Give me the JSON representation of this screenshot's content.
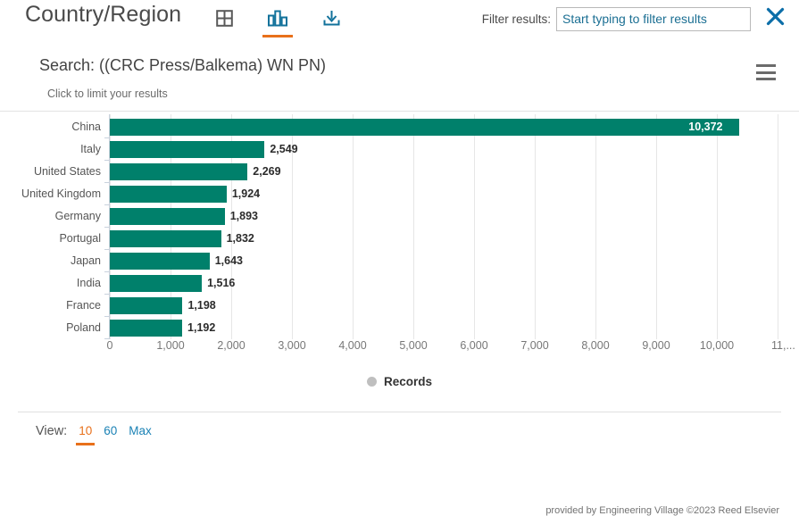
{
  "header": {
    "title": "Country/Region",
    "icons": [
      {
        "name": "table-view-icon",
        "label": "Table view"
      },
      {
        "name": "bar-chart-view-icon",
        "label": "Bar chart view",
        "active": true
      },
      {
        "name": "download-icon",
        "label": "Download"
      }
    ],
    "filter_label": "Filter results:",
    "filter_placeholder": "Start typing to filter results",
    "filter_value": "",
    "close_label": "Close"
  },
  "search": {
    "query_line": "Search: ((CRC Press/Balkema) WN PN)",
    "hint": "Click to limit your results",
    "menu_icon": "hamburger-menu-icon"
  },
  "chart_data": {
    "type": "bar",
    "orientation": "horizontal",
    "title": "",
    "xlabel": "",
    "ylabel": "",
    "categories": [
      "China",
      "Italy",
      "United States",
      "United Kingdom",
      "Germany",
      "Portugal",
      "Japan",
      "India",
      "France",
      "Poland"
    ],
    "values": [
      10372,
      2549,
      2269,
      1924,
      1893,
      1832,
      1643,
      1516,
      1198,
      1192
    ],
    "value_labels": [
      "10,372",
      "2,549",
      "2,269",
      "1,924",
      "1,893",
      "1,832",
      "1,643",
      "1,516",
      "1,198",
      "1,192"
    ],
    "xlim": [
      0,
      11000
    ],
    "xticks": [
      0,
      1000,
      2000,
      3000,
      4000,
      5000,
      6000,
      7000,
      8000,
      9000,
      10000,
      11000
    ],
    "xtick_labels": [
      "0",
      "1,000",
      "2,000",
      "3,000",
      "4,000",
      "5,000",
      "6,000",
      "7,000",
      "8,000",
      "9,000",
      "10,000",
      "11,..."
    ],
    "grid": true,
    "legend": {
      "position": "bottom",
      "entries": [
        "Records"
      ]
    },
    "series_name": "Records",
    "bar_color": "#00806b"
  },
  "credit": "provided by Engineering Village ©2023 Reed Elsevier",
  "footer": {
    "view_label": "View:",
    "options": [
      {
        "label": "10",
        "active": true
      },
      {
        "label": "60",
        "active": false
      },
      {
        "label": "Max",
        "active": false
      }
    ]
  },
  "colors": {
    "bar": "#00806b",
    "accent_orange": "#e8701a",
    "link_blue": "#1b82b5",
    "icon_blue": "#1b6f93"
  }
}
